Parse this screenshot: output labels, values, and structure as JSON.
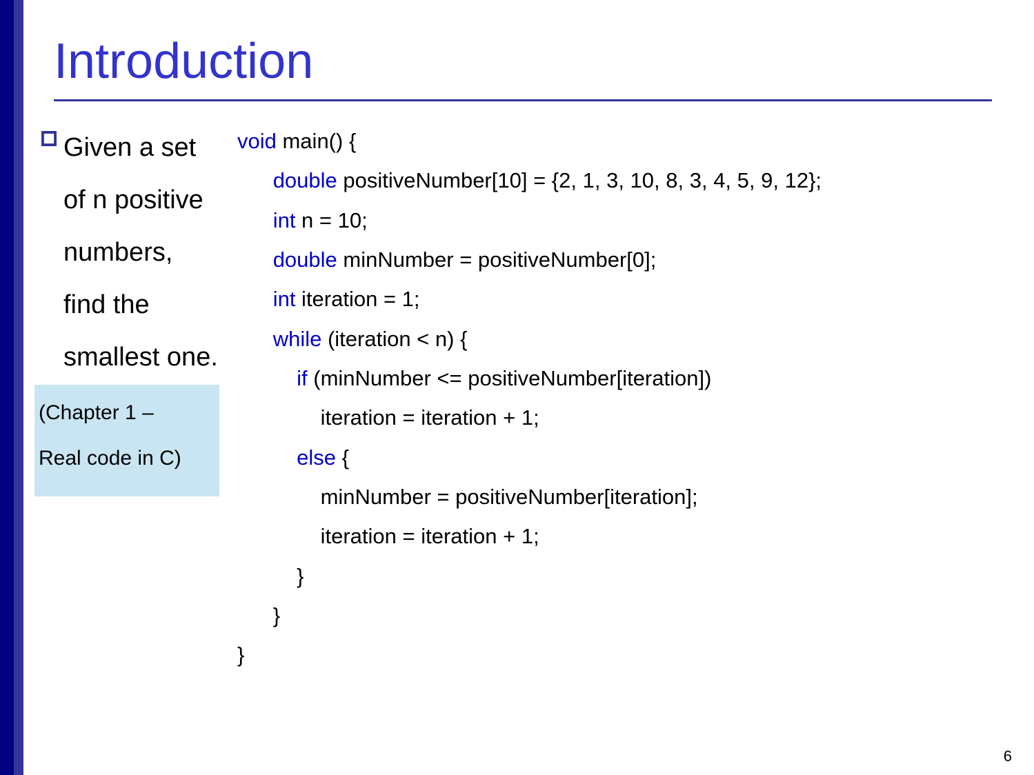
{
  "title": "Introduction",
  "bullet": "Given a set of n positive numbers, find the smallest one.",
  "chapter_lines": [
    "(Chapter 1 –",
    "Real code in C)"
  ],
  "code": {
    "l1_kw": "void",
    "l1_rest": " main() {",
    "l2_kw": "double",
    "l2_rest": " positiveNumber[10] = {2, 1, 3, 10, 8, 3, 4, 5, 9, 12};",
    "l3_kw": "int",
    "l3_rest": " n = 10;",
    "l4_kw": "double",
    "l4_rest": " minNumber = positiveNumber[0];",
    "l5_kw": "int",
    "l5_rest": " iteration = 1;",
    "l6_kw": "while",
    "l6_rest": " (iteration < n) {",
    "l7_kw": "if",
    "l7_rest": " (minNumber <= positiveNumber[iteration])",
    "l8": "iteration = iteration + 1;",
    "l9_kw": "else",
    "l9_rest": " {",
    "l10": "minNumber = positiveNumber[iteration];",
    "l11": "iteration = iteration + 1;",
    "l12": "}",
    "l13": "}",
    "l14": "}"
  },
  "page_number": "6"
}
